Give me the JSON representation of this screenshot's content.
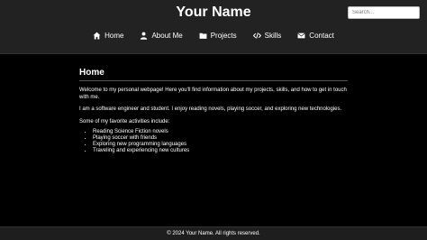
{
  "header": {
    "title": "Your Name",
    "search_placeholder": "Search..."
  },
  "nav": {
    "items": [
      {
        "label": "Home",
        "icon": "home-icon"
      },
      {
        "label": "About Me",
        "icon": "user-icon"
      },
      {
        "label": "Projects",
        "icon": "folder-icon"
      },
      {
        "label": "Skills",
        "icon": "code-icon"
      },
      {
        "label": "Contact",
        "icon": "envelope-icon"
      }
    ]
  },
  "main": {
    "heading": "Home",
    "intro": "Welcome to my personal webpage! Here you'll find information about my projects, skills, and how to get in touch with me.",
    "bio": "I am a software engineer and student. I enjoy reading novels, playing soccer, and exploring new technologies.",
    "activities_heading": "Some of my favorite activities include:",
    "activities": [
      "Reading Science Fiction novels",
      "Playing soccer with friends",
      "Exploring new programming languages",
      "Traveling and experiencing new cultures"
    ]
  },
  "footer": {
    "text": "© 2024 Your Name. All rights reserved."
  }
}
